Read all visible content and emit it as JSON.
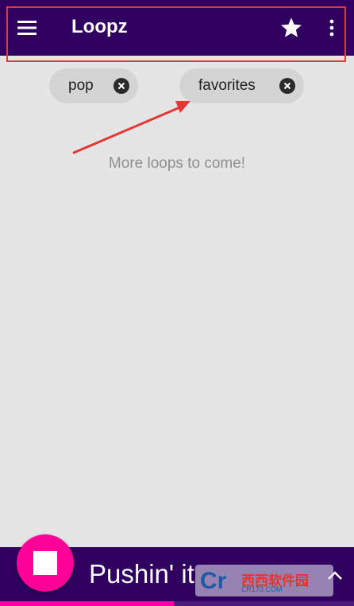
{
  "app_bar": {
    "title": "Loopz",
    "icons": [
      "menu-icon",
      "star-icon",
      "more-vert-icon"
    ],
    "background": "#300060"
  },
  "filters": {
    "chips": [
      {
        "label": "pop",
        "icon": "close-circle-icon"
      },
      {
        "label": "favorites",
        "icon": "close-circle-icon"
      }
    ]
  },
  "content": {
    "empty_message": "More loops to come!"
  },
  "annotation": {
    "color": "#e53935",
    "shape": "highlight-frame-and-arrow"
  },
  "player": {
    "track_title": "Pushin' it",
    "stop_icon": "stop-icon",
    "expand_icon": "chevron-up-icon",
    "accent": "#ff0099",
    "progress": 0.49
  },
  "watermark": {
    "brand": "西西软件园",
    "domain": "CR173.COM"
  }
}
